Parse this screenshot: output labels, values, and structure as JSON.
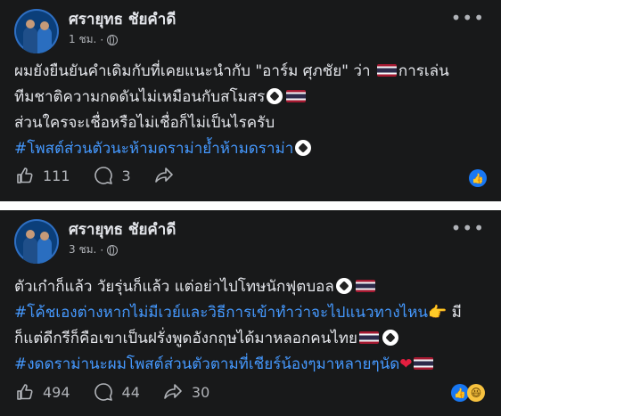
{
  "posts": [
    {
      "author": "ศรายุทธ ชัยคำดี",
      "time": "1 ชม.",
      "lines": [
        "ผมยังยืนยันคำเดิมกับที่เคยแนะนำกับ \"อาร์ม ศุภชัย\" ว่า",
        "การเล่น",
        "ทีมชาติความกดดันไม่เหมือนกับสโมสร",
        "ส่วนใครจะเชื่อหรือไม่เชื่อก็ไม่เป็นไรครับ",
        "#โพสต์ส่วนตัวนะห้ามดราม่าย้ำห้ามดราม่า"
      ],
      "likes": "111",
      "comments": "3",
      "shares": ""
    },
    {
      "author": "ศรายุทธ ชัยคำดี",
      "time": "3 ชม.",
      "lines": [
        "ตัวเก๋าก็แล้ว วัยรุ่นก็แล้ว แต่อย่าไปโทษนักฟุตบอล",
        "#โค้ชเองต่างหากไม่มีเวย์และวิธีการเข้าทำว่าจะไปแนวทางไหน",
        "มี",
        "ก็แต่ดีกรีก็คือเขาเป็นฝรั่งพูดอังกฤษได้มาหลอกคนไทย",
        "#งดดราม่านะผมโพสต์ส่วนตัวตามที่เชียร์น้องๆมาหลายๆนัด"
      ],
      "likes": "494",
      "comments": "44",
      "shares": "30"
    }
  ],
  "colors": {
    "background": "#18191a",
    "text": "#e4e6eb",
    "muted": "#b0b3b8",
    "hashtag": "#4599ff",
    "like": "#1877f2"
  }
}
